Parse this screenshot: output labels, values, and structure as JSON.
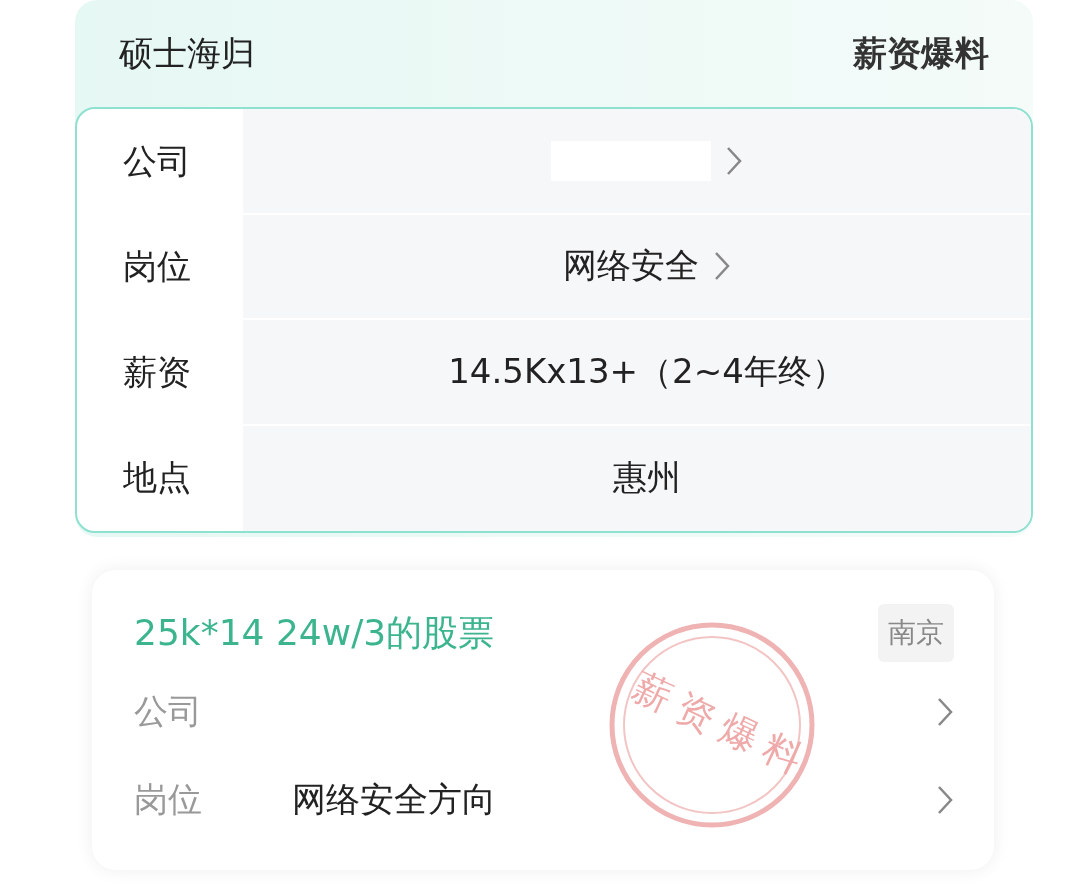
{
  "header": {
    "title": "硕士海归",
    "action": "薪资爆料"
  },
  "details": [
    {
      "label": "公司",
      "kind": "redacted",
      "link": true
    },
    {
      "label": "岗位",
      "kind": "text",
      "value": "网络安全",
      "link": true
    },
    {
      "label": "薪资",
      "kind": "text",
      "value": "14.5Kx13+（2~4年终）",
      "link": false
    },
    {
      "label": "地点",
      "kind": "text",
      "value": "惠州",
      "link": false
    }
  ],
  "post": {
    "salary": "25k*14 24w/3的股票",
    "city": "南京",
    "stamp": "薪资爆料",
    "rows": [
      {
        "label": "公司"
      },
      {
        "label": "岗位",
        "value": "网络安全方向"
      }
    ]
  }
}
